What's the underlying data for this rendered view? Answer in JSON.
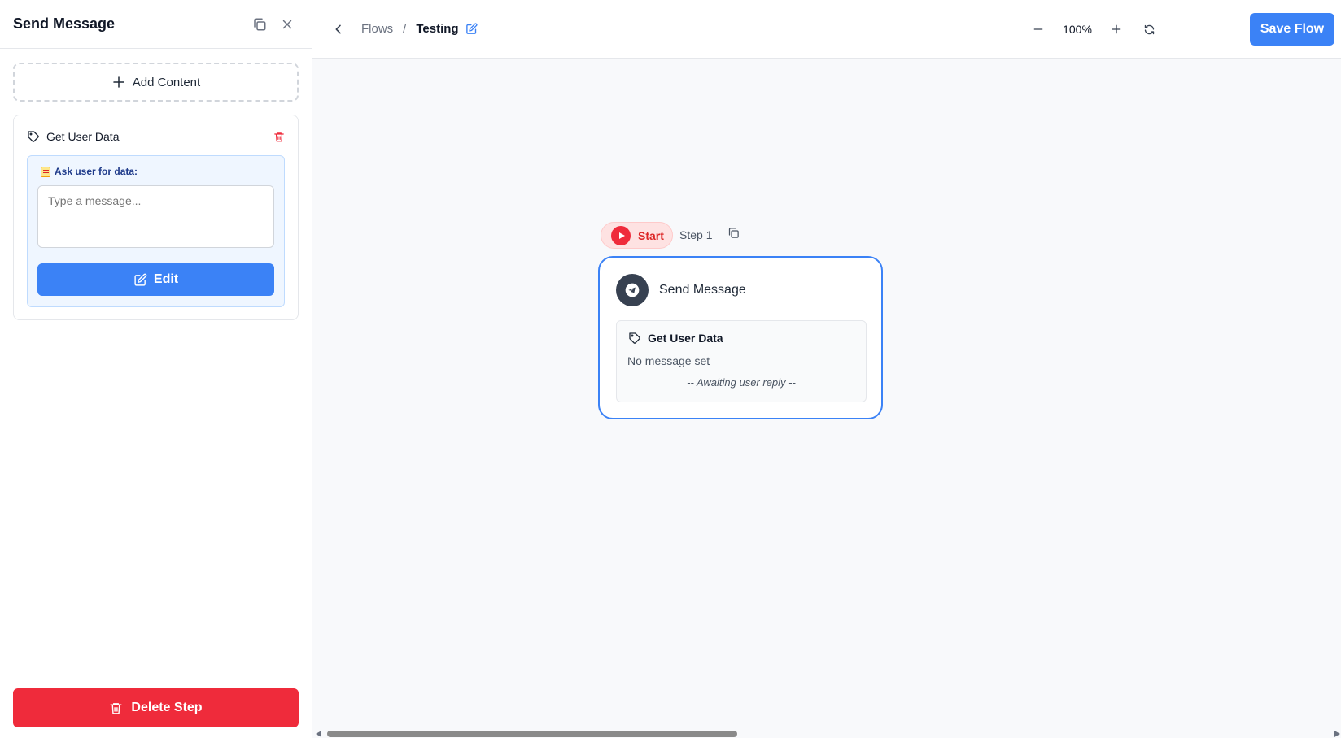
{
  "sidebar": {
    "title": "Send Message",
    "add_content_label": "Add Content",
    "content_card": {
      "title": "Get User Data",
      "prompt_label": "Ask user for data:",
      "message_placeholder": "Type a message...",
      "message_value": "",
      "edit_label": "Edit"
    },
    "delete_label": "Delete Step"
  },
  "topbar": {
    "breadcrumb_parent": "Flows",
    "breadcrumb_separator": "/",
    "breadcrumb_current": "Testing",
    "zoom_level": "100%",
    "save_label": "Save Flow"
  },
  "canvas": {
    "start_label": "Start",
    "step_label": "Step 1",
    "node": {
      "title": "Send Message",
      "content_title": "Get User Data",
      "content_message": "No message set",
      "content_status": "-- Awaiting user reply --"
    }
  },
  "colors": {
    "primary": "#3b82f6",
    "danger": "#ef2b3b",
    "canvas_bg": "#f8f9fb"
  },
  "icons": [
    "copy-icon",
    "close-icon",
    "plus-icon",
    "tag-icon",
    "trash-icon",
    "memo-icon",
    "edit-icon",
    "chevron-left-icon",
    "minus-icon",
    "refresh-icon",
    "play-icon",
    "paper-plane-icon"
  ]
}
